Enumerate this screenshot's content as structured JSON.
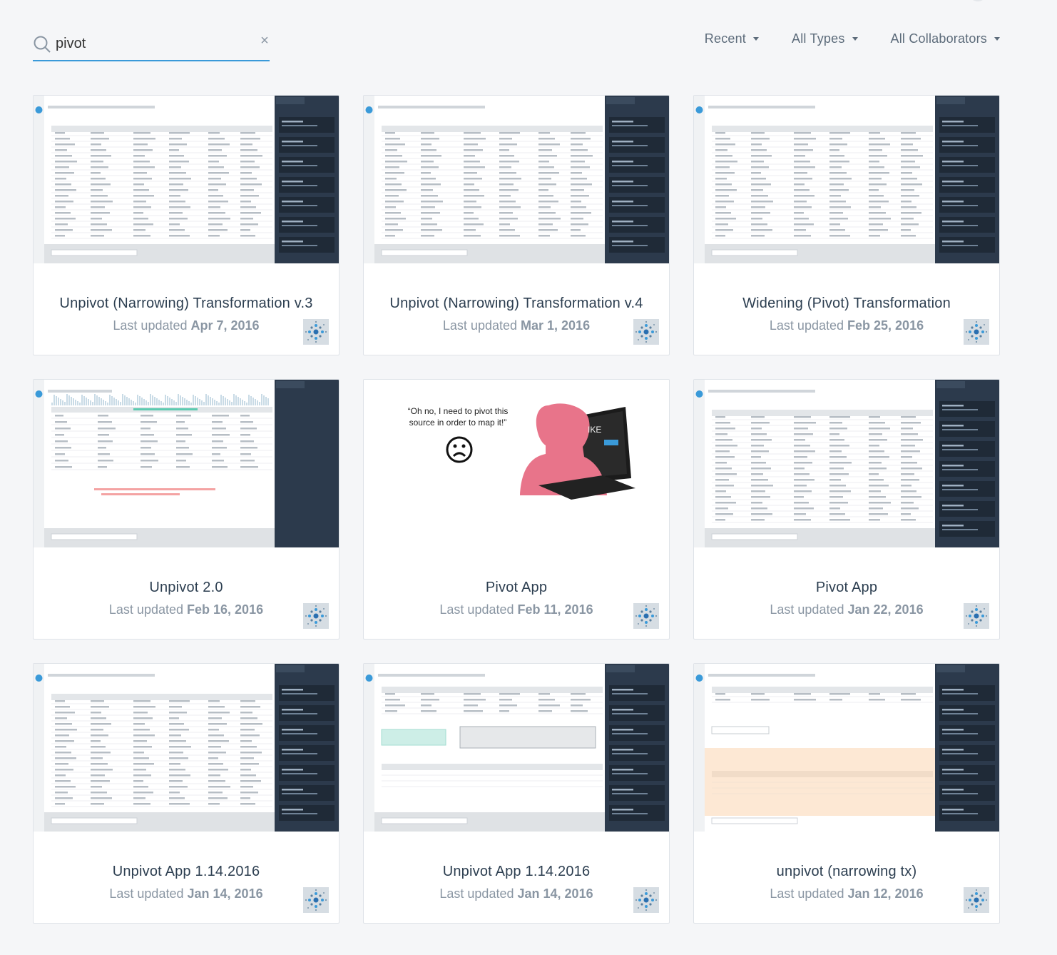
{
  "search": {
    "value": "pivot",
    "placeholder": "Search"
  },
  "filters": [
    {
      "label": "Recent"
    },
    {
      "label": "All Types"
    },
    {
      "label": "All Collaborators"
    }
  ],
  "updated_prefix": "Last updated",
  "cards": [
    {
      "title": "Unpivot (Narrowing) Transformation v.3",
      "date": "Apr 7, 2016",
      "thumb": "dark-table"
    },
    {
      "title": "Unpivot (Narrowing) Transformation v.4",
      "date": "Mar 1, 2016",
      "thumb": "dark-table"
    },
    {
      "title": "Widening (Pivot) Transformation",
      "date": "Feb 25, 2016",
      "thumb": "dark-table"
    },
    {
      "title": "Unpivot 2.0",
      "date": "Feb 16, 2016",
      "thumb": "dark-histogram"
    },
    {
      "title": "Pivot App",
      "date": "Feb 11, 2016",
      "thumb": "illustration"
    },
    {
      "title": "Pivot App",
      "date": "Jan 22, 2016",
      "thumb": "dark-table"
    },
    {
      "title": "Unpivot App 1.14.2016",
      "date": "Jan 14, 2016",
      "thumb": "dark-table"
    },
    {
      "title": "Unpivot App 1.14.2016",
      "date": "Jan 14, 2016",
      "thumb": "dark-builder"
    },
    {
      "title": "unpivot (narrowing tx)",
      "date": "Jan 12, 2016",
      "thumb": "dark-preview"
    }
  ],
  "illustration": {
    "quote": "“Oh no, I need to pivot this source in order to map it!”",
    "laptop_label": "IKE"
  },
  "colors": {
    "accent": "#3a9ad9",
    "panel": "#2c3a4c",
    "figure_pink": "#e8748a"
  }
}
